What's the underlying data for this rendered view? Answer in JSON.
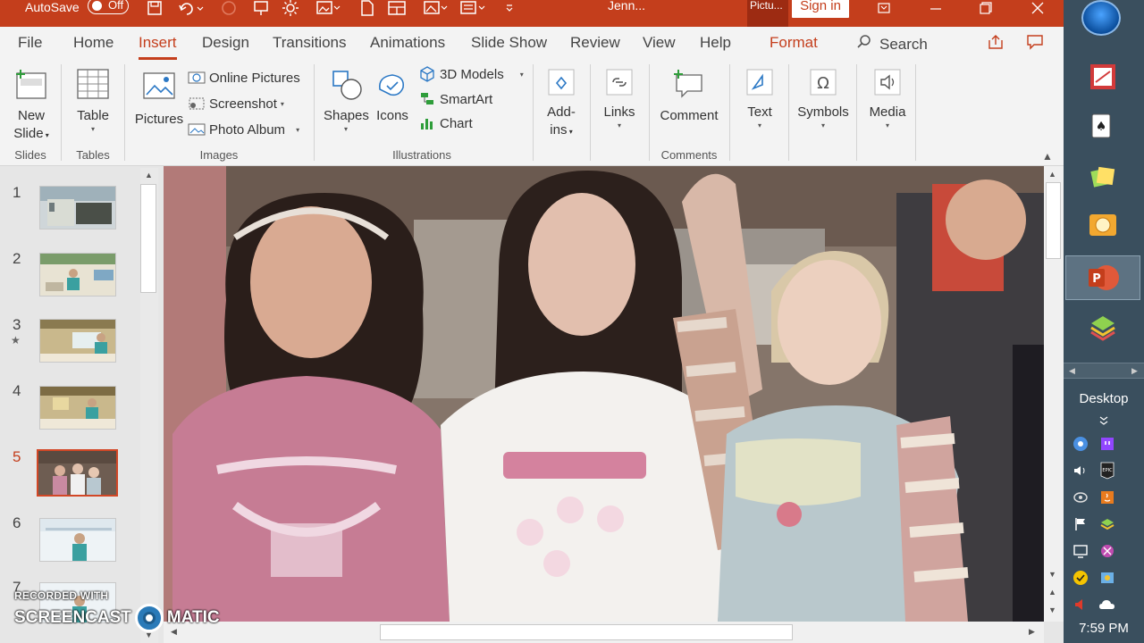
{
  "titlebar": {
    "autosave_label": "AutoSave",
    "autosave_state": "Off",
    "doc_title": "Jenn...",
    "context_tab": "Pictu...",
    "signin": "Sign in",
    "accent": "#c43e1c"
  },
  "tabs": [
    {
      "label": "File"
    },
    {
      "label": "Home"
    },
    {
      "label": "Insert"
    },
    {
      "label": "Design"
    },
    {
      "label": "Transitions"
    },
    {
      "label": "Animations"
    },
    {
      "label": "Slide Show"
    },
    {
      "label": "Review"
    },
    {
      "label": "View"
    },
    {
      "label": "Help"
    },
    {
      "label": "Format"
    }
  ],
  "search_label": "Search",
  "ribbon": {
    "slides": {
      "new_slide_1": "New",
      "new_slide_2": "Slide",
      "group": "Slides"
    },
    "tables": {
      "table": "Table",
      "group": "Tables"
    },
    "images": {
      "pictures": "Pictures",
      "online_pictures": "Online Pictures",
      "screenshot": "Screenshot",
      "photo_album": "Photo Album",
      "group": "Images"
    },
    "illustrations": {
      "shapes": "Shapes",
      "icons": "Icons",
      "models": "3D Models",
      "smartart": "SmartArt",
      "chart": "Chart",
      "group": "Illustrations"
    },
    "addins": {
      "line1": "Add-",
      "line2": "ins"
    },
    "links": {
      "label": "Links"
    },
    "comments": {
      "comment": "Comment",
      "group": "Comments"
    },
    "text": {
      "label": "Text"
    },
    "symbols": {
      "label": "Symbols"
    },
    "media": {
      "label": "Media"
    }
  },
  "slides": [
    {
      "num": "1"
    },
    {
      "num": "2"
    },
    {
      "num": "3"
    },
    {
      "num": "4"
    },
    {
      "num": "5"
    },
    {
      "num": "6"
    },
    {
      "num": "7"
    }
  ],
  "active_slide": "5",
  "watermark": {
    "line1": "RECORDED WITH",
    "line2a": "SCREENCAST",
    "line2b": "MATIC"
  },
  "taskbar": {
    "desktop": "Desktop",
    "clock": "7:59 PM"
  }
}
